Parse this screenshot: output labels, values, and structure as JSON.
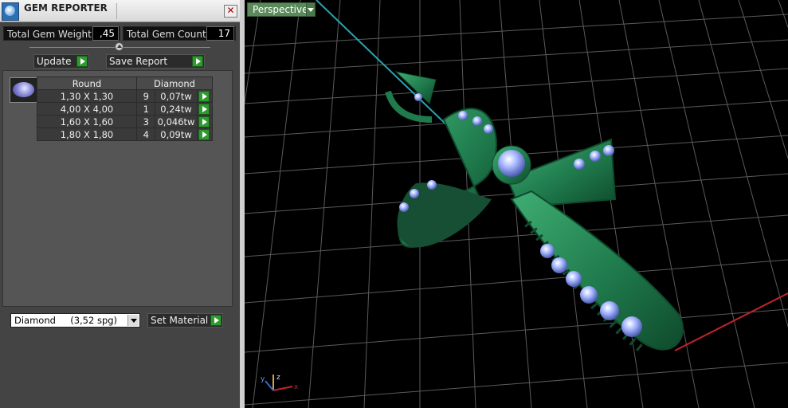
{
  "window": {
    "title": "GEM REPORTER",
    "close_icon": "close-icon"
  },
  "stats": {
    "total_weight_label": "Total Gem Weight",
    "total_weight_value": ",45",
    "total_count_label": "Total Gem Count",
    "total_count_value": "17"
  },
  "actions": {
    "update_label": "Update",
    "save_report_label": "Save Report"
  },
  "table": {
    "headers": [
      "Round",
      "Diamond"
    ],
    "rows": [
      {
        "size": "1,30 X 1,30",
        "count": "9",
        "weight": "0,07tw"
      },
      {
        "size": "4,00 X 4,00",
        "count": "1",
        "weight": "0,24tw"
      },
      {
        "size": "1,60 X 1,60",
        "count": "3",
        "weight": "0,046tw"
      },
      {
        "size": "1,80 X 1,80",
        "count": "4",
        "weight": "0,09tw"
      }
    ]
  },
  "material": {
    "selected": "Diamond     (3,52 spg)",
    "set_material_label": "Set Material"
  },
  "viewport": {
    "label": "Perspective",
    "axis_labels": {
      "x": "x",
      "y": "y",
      "z": "z"
    }
  },
  "colors": {
    "metal": "#1f7a4c",
    "gem": "#a8b8ff",
    "grid": "#5a5a5a",
    "x_axis": "#c0242a",
    "y_axis": "#2aa3b0",
    "play": "#2f9a2f"
  }
}
